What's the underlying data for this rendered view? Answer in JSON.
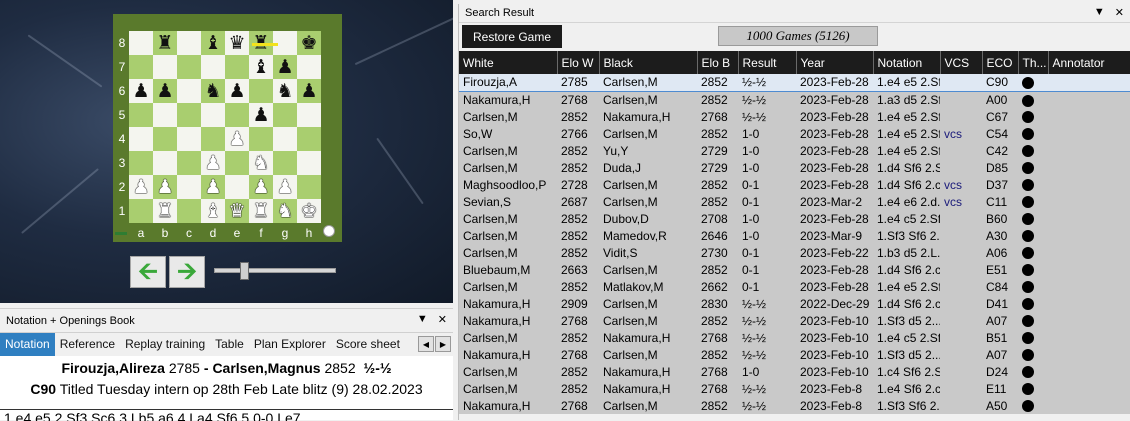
{
  "board": {
    "ranks": [
      "8",
      "7",
      "6",
      "5",
      "4",
      "3",
      "2",
      "1"
    ],
    "files": [
      "a",
      "b",
      "c",
      "d",
      "e",
      "f",
      "g",
      "h"
    ],
    "position": [
      [
        "",
        "r",
        "",
        "b",
        "q",
        "r",
        "",
        "k"
      ],
      [
        "",
        "",
        "",
        "",
        "",
        "b",
        "p",
        ""
      ],
      [
        "p",
        "p",
        "",
        "n",
        "p",
        "",
        "n",
        "p"
      ],
      [
        "",
        "",
        "",
        "",
        "",
        "p",
        "",
        ""
      ],
      [
        "",
        "",
        "",
        "",
        "P",
        "",
        "",
        ""
      ],
      [
        "",
        "",
        "",
        "P",
        "",
        "N",
        "",
        ""
      ],
      [
        "P",
        "P",
        "",
        "P",
        "",
        "P",
        "P",
        ""
      ],
      [
        "",
        "R",
        "",
        "B",
        "Q",
        "R",
        "N",
        "K"
      ]
    ]
  },
  "nav": {
    "back_icon": "arrow-left-icon",
    "forward_icon": "arrow-right-icon"
  },
  "notation": {
    "title": "Notation + Openings Book",
    "tabs": [
      "Notation",
      "Reference",
      "Replay training",
      "Table",
      "Plan Explorer",
      "Score sheet"
    ],
    "active_tab": 0,
    "white": "Firouzja,Alireza",
    "white_elo": "2785",
    "separator": " - ",
    "black": "Carlsen,Magnus",
    "black_elo": "2852",
    "result": "½-½",
    "eco": "C90",
    "event": "Titled Tuesday intern op 28th Feb Late blitz (9) 28.02.2023",
    "moves": "1.e4 e5 2.Sf3 Sc6 3.Lb5 a6 4.La4 Sf6 5.0-0 Le7"
  },
  "search": {
    "title": "Search Result",
    "restore_label": "Restore Game",
    "games_count": "1000 Games (5126)",
    "columns": [
      "White",
      "Elo W",
      "Black",
      "Elo B",
      "Result",
      "Year",
      "Notation",
      "VCS",
      "ECO",
      "Th...",
      "Annotator"
    ],
    "rows": [
      [
        "Firouzja,A",
        "2785",
        "Carlsen,M",
        "2852",
        "½-½",
        "2023-Feb-28",
        "1.e4 e5 2.Sf...",
        "",
        "C90"
      ],
      [
        "Nakamura,H",
        "2768",
        "Carlsen,M",
        "2852",
        "½-½",
        "2023-Feb-28",
        "1.a3 d5 2.Sf...",
        "",
        "A00"
      ],
      [
        "Carlsen,M",
        "2852",
        "Nakamura,H",
        "2768",
        "½-½",
        "2023-Feb-28",
        "1.e4 e5 2.Sf...",
        "",
        "C67"
      ],
      [
        "So,W",
        "2766",
        "Carlsen,M",
        "2852",
        "1-0",
        "2023-Feb-28",
        "1.e4 e5 2.Sf...",
        "vcs",
        "C54"
      ],
      [
        "Carlsen,M",
        "2852",
        "Yu,Y",
        "2729",
        "1-0",
        "2023-Feb-28",
        "1.e4 e5 2.Sf...",
        "",
        "C42"
      ],
      [
        "Carlsen,M",
        "2852",
        "Duda,J",
        "2729",
        "1-0",
        "2023-Feb-28",
        "1.d4 Sf6 2.S...",
        "",
        "D85"
      ],
      [
        "Maghsoodloo,P",
        "2728",
        "Carlsen,M",
        "2852",
        "0-1",
        "2023-Feb-28",
        "1.d4 Sf6 2.c...",
        "vcs",
        "D37"
      ],
      [
        "Sevian,S",
        "2687",
        "Carlsen,M",
        "2852",
        "0-1",
        "2023-Mar-2",
        "1.e4 e6 2.d...",
        "vcs",
        "C11"
      ],
      [
        "Carlsen,M",
        "2852",
        "Dubov,D",
        "2708",
        "1-0",
        "2023-Feb-28",
        "1.e4 c5 2.Sf...",
        "",
        "B60"
      ],
      [
        "Carlsen,M",
        "2852",
        "Mamedov,R",
        "2646",
        "1-0",
        "2023-Mar-9",
        "1.Sf3 Sf6 2....",
        "",
        "A30"
      ],
      [
        "Carlsen,M",
        "2852",
        "Vidit,S",
        "2730",
        "0-1",
        "2023-Feb-22",
        "1.b3 d5 2.L...",
        "",
        "A06"
      ],
      [
        "Bluebaum,M",
        "2663",
        "Carlsen,M",
        "2852",
        "0-1",
        "2023-Feb-28",
        "1.d4 Sf6 2.c...",
        "",
        "E51"
      ],
      [
        "Carlsen,M",
        "2852",
        "Matlakov,M",
        "2662",
        "0-1",
        "2023-Feb-28",
        "1.e4 e5 2.Sf...",
        "",
        "C84"
      ],
      [
        "Nakamura,H",
        "2909",
        "Carlsen,M",
        "2830",
        "½-½",
        "2022-Dec-29",
        "1.d4 Sf6 2.c...",
        "",
        "D41"
      ],
      [
        "Nakamura,H",
        "2768",
        "Carlsen,M",
        "2852",
        "½-½",
        "2023-Feb-10",
        "1.Sf3 d5 2....",
        "",
        "A07"
      ],
      [
        "Carlsen,M",
        "2852",
        "Nakamura,H",
        "2768",
        "½-½",
        "2023-Feb-10",
        "1.e4 c5 2.Sf...",
        "",
        "B51"
      ],
      [
        "Nakamura,H",
        "2768",
        "Carlsen,M",
        "2852",
        "½-½",
        "2023-Feb-10",
        "1.Sf3 d5 2....",
        "",
        "A07"
      ],
      [
        "Carlsen,M",
        "2852",
        "Nakamura,H",
        "2768",
        "1-0",
        "2023-Feb-10",
        "1.c4 Sf6 2.S...",
        "",
        "D24"
      ],
      [
        "Carlsen,M",
        "2852",
        "Nakamura,H",
        "2768",
        "½-½",
        "2023-Feb-8",
        "1.e4 Sf6 2.c...",
        "",
        "E11"
      ],
      [
        "Nakamura,H",
        "2768",
        "Carlsen,M",
        "2852",
        "½-½",
        "2023-Feb-8",
        "1.Sf3 Sf6 2....",
        "",
        "A50"
      ]
    ]
  },
  "colors": {
    "board_light": "#f4f5ef",
    "board_dark": "#a9ce6f",
    "board_frame": "#5a7a2c",
    "tab_active": "#2f7fc1",
    "header_bg": "#1c1c1c"
  }
}
